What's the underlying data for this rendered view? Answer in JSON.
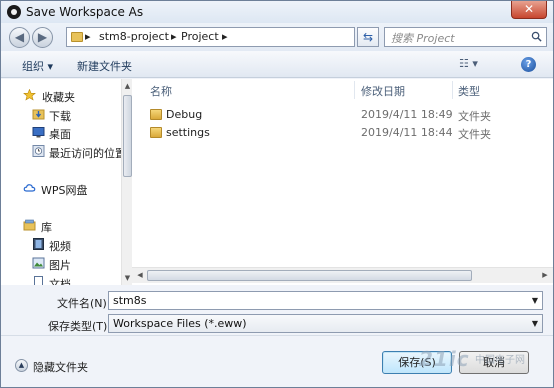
{
  "window": {
    "title": "Save Workspace As",
    "close_glyph": "✕"
  },
  "address": {
    "breadcrumbs": [
      "stm8-project",
      "Project"
    ],
    "separator": "▸",
    "search_placeholder": "搜索 Project"
  },
  "toolbar": {
    "organize": "组织 ▾",
    "new_folder": "新建文件夹",
    "view": "☷ ▾",
    "help": "?"
  },
  "nav": {
    "items": [
      {
        "label": "收藏夹",
        "icon": "star-icon"
      },
      {
        "label": "下载",
        "icon": "download-folder-icon"
      },
      {
        "label": "桌面",
        "icon": "desktop-icon"
      },
      {
        "label": "最近访问的位置",
        "icon": "recent-places-icon"
      },
      {
        "label": "WPS网盘",
        "icon": "cloud-icon"
      },
      {
        "label": "库",
        "icon": "library-icon"
      },
      {
        "label": "视频",
        "icon": "video-icon"
      },
      {
        "label": "图片",
        "icon": "pictures-icon"
      },
      {
        "label": "文档",
        "icon": "documents-icon"
      }
    ]
  },
  "files": {
    "columns": {
      "name": "名称",
      "modified": "修改日期",
      "type": "类型"
    },
    "rows": [
      {
        "name": "Debug",
        "modified": "2019/4/11 18:49",
        "type": "文件夹"
      },
      {
        "name": "settings",
        "modified": "2019/4/11 18:44",
        "type": "文件夹"
      }
    ]
  },
  "form": {
    "filename_label": "文件名(N):",
    "filename_value": "stm8s",
    "filetype_label": "保存类型(T):",
    "filetype_value": "Workspace Files (*.eww)"
  },
  "footer": {
    "hide_folders": "隐藏文件夹",
    "save": "保存(S)",
    "cancel": "取消"
  },
  "watermark": {
    "text": "21ic",
    "sub": "中国电子网"
  }
}
